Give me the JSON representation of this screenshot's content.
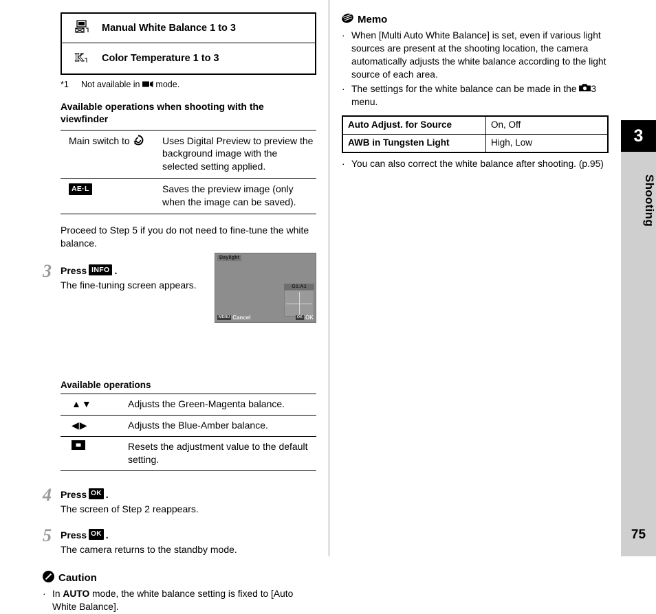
{
  "page": {
    "number": "75",
    "chapter_number": "3",
    "chapter_label": "Shooting"
  },
  "left": {
    "wb_table": [
      {
        "icon": "manual-white-balance-icon",
        "label": "Manual White Balance 1 to 3"
      },
      {
        "icon": "color-temperature-k-icon",
        "label": "Color Temperature 1 to 3"
      }
    ],
    "footnote": {
      "mark": "*1",
      "text": "Not available in ■▸ mode."
    },
    "viewfinder_heading": "Available operations when shooting with the viewfinder",
    "viewfinder_ops": [
      {
        "key_text": "Main switch to",
        "key_icon": "digital-preview-dial-icon",
        "value": "Uses Digital Preview to preview the background image with the selected setting applied."
      },
      {
        "key_text": "",
        "key_icon": "ael-button-icon",
        "value": "Saves the preview image (only when the image can be saved)."
      }
    ],
    "proceed_text": "Proceed to Step 5 if you do not need to fine-tune the white balance.",
    "steps": [
      {
        "num": "3",
        "title_prefix": "Press",
        "button": "INFO",
        "title_suffix": ".",
        "body": "The fine-tuning screen appears."
      },
      {
        "num": "4",
        "title_prefix": "Press",
        "button": "OK",
        "title_suffix": ".",
        "body": "The screen of Step 2 reappears."
      },
      {
        "num": "5",
        "title_prefix": "Press",
        "button": "OK",
        "title_suffix": ".",
        "body": "The camera returns to the standby mode."
      }
    ],
    "lcd": {
      "wb_mode": "Daylight",
      "adjust_value": "G1:A1",
      "cancel_key": "MENU",
      "cancel_label": "Cancel",
      "ok_key": "OK",
      "ok_label": "OK"
    },
    "ops_heading": "Available operations",
    "fine_tune_ops": [
      {
        "key": "▲▼",
        "key_name": "up-down-arrows-icon",
        "value": "Adjusts the Green-Magenta balance."
      },
      {
        "key": "◀▶",
        "key_name": "left-right-arrows-icon",
        "value": "Adjusts the Blue-Amber balance."
      },
      {
        "key": "■",
        "key_name": "green-button-icon",
        "value": "Resets the adjustment value to the default setting."
      }
    ],
    "caution": {
      "heading": "Caution",
      "items": [
        "In AUTO mode, the white balance setting is fixed to [Auto White Balance]."
      ],
      "item_prefix": "In",
      "item_mode": "AUTO",
      "item_rest": "mode, the white balance setting is fixed to [Auto White Balance]."
    }
  },
  "right": {
    "memo": {
      "heading": "Memo",
      "items": [
        "When [Multi Auto White Balance] is set, even if various light sources are present at the shooting location, the camera automatically adjusts the white balance according to the light source of each area.",
        "The settings for the white balance can be made in the ●3 menu.",
        "You can also correct the white balance after shooting. (p.95)"
      ],
      "item2_prefix": "The settings for the white balance can be made in the",
      "item2_menu": "3",
      "item2_suffix": "menu."
    },
    "settings_table": [
      {
        "name": "Auto Adjust. for Source",
        "values": "On, Off"
      },
      {
        "name": "AWB in Tungsten Light",
        "values": "High, Low"
      }
    ]
  },
  "colors": {
    "tab_gray": "#cfcfcf",
    "tab_black": "#000000",
    "step_number_gray": "#9a9a9a",
    "lcd_gray": "#8d8d8d"
  }
}
